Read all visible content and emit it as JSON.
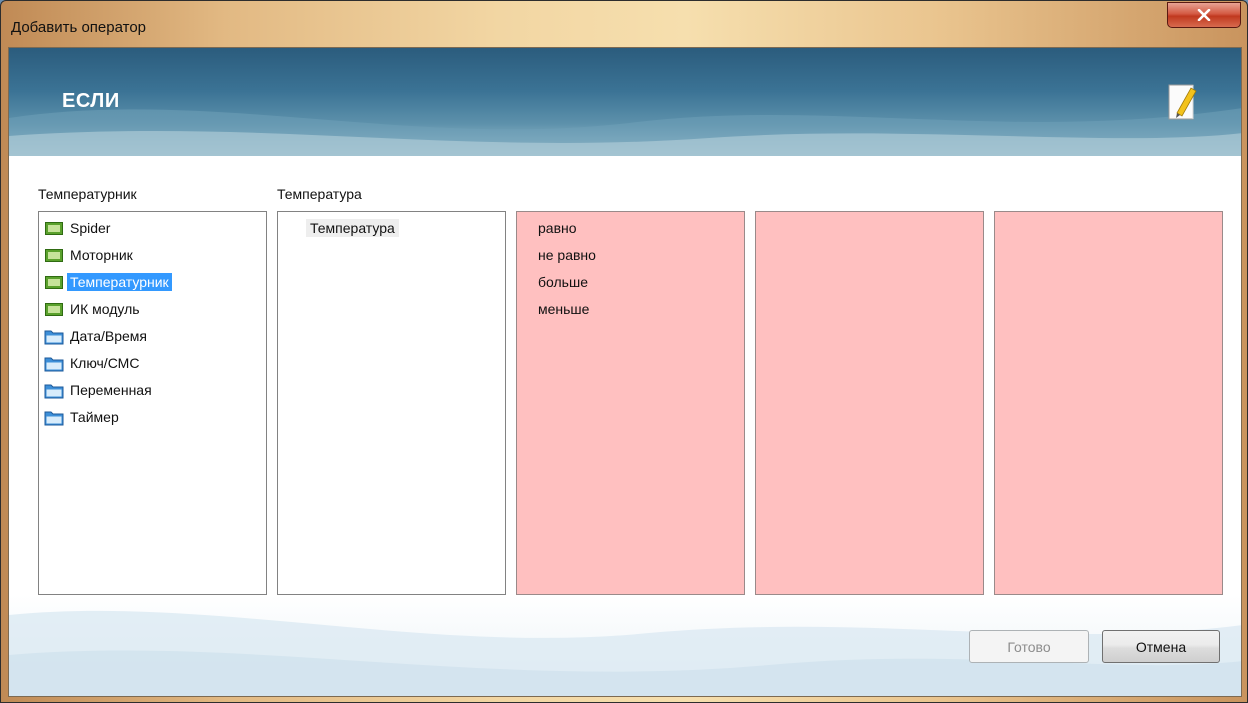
{
  "window": {
    "title": "Добавить оператор"
  },
  "banner": {
    "title": "ЕСЛИ"
  },
  "columns": {
    "devices_label": "Температурник",
    "params_label": "Температура"
  },
  "devices": [
    {
      "label": "Spider",
      "icon": "device-icon"
    },
    {
      "label": "Моторник",
      "icon": "device-icon"
    },
    {
      "label": "Температурник",
      "icon": "device-icon",
      "selected": true
    },
    {
      "label": "ИК модуль",
      "icon": "device-icon"
    },
    {
      "label": "Дата/Время",
      "icon": "folder-icon"
    },
    {
      "label": "Ключ/СМС",
      "icon": "folder-icon"
    },
    {
      "label": "Переменная",
      "icon": "folder-icon"
    },
    {
      "label": "Таймер",
      "icon": "folder-icon"
    }
  ],
  "params": [
    {
      "label": "Температура"
    }
  ],
  "operators": [
    {
      "label": "равно"
    },
    {
      "label": "не равно"
    },
    {
      "label": "больше"
    },
    {
      "label": "меньше"
    }
  ],
  "buttons": {
    "ok_label": "Готово",
    "cancel_label": "Отмена"
  },
  "colors": {
    "selection": "#3399ff",
    "pink_panel": "#ffc0c0",
    "banner": "#3b7395"
  }
}
